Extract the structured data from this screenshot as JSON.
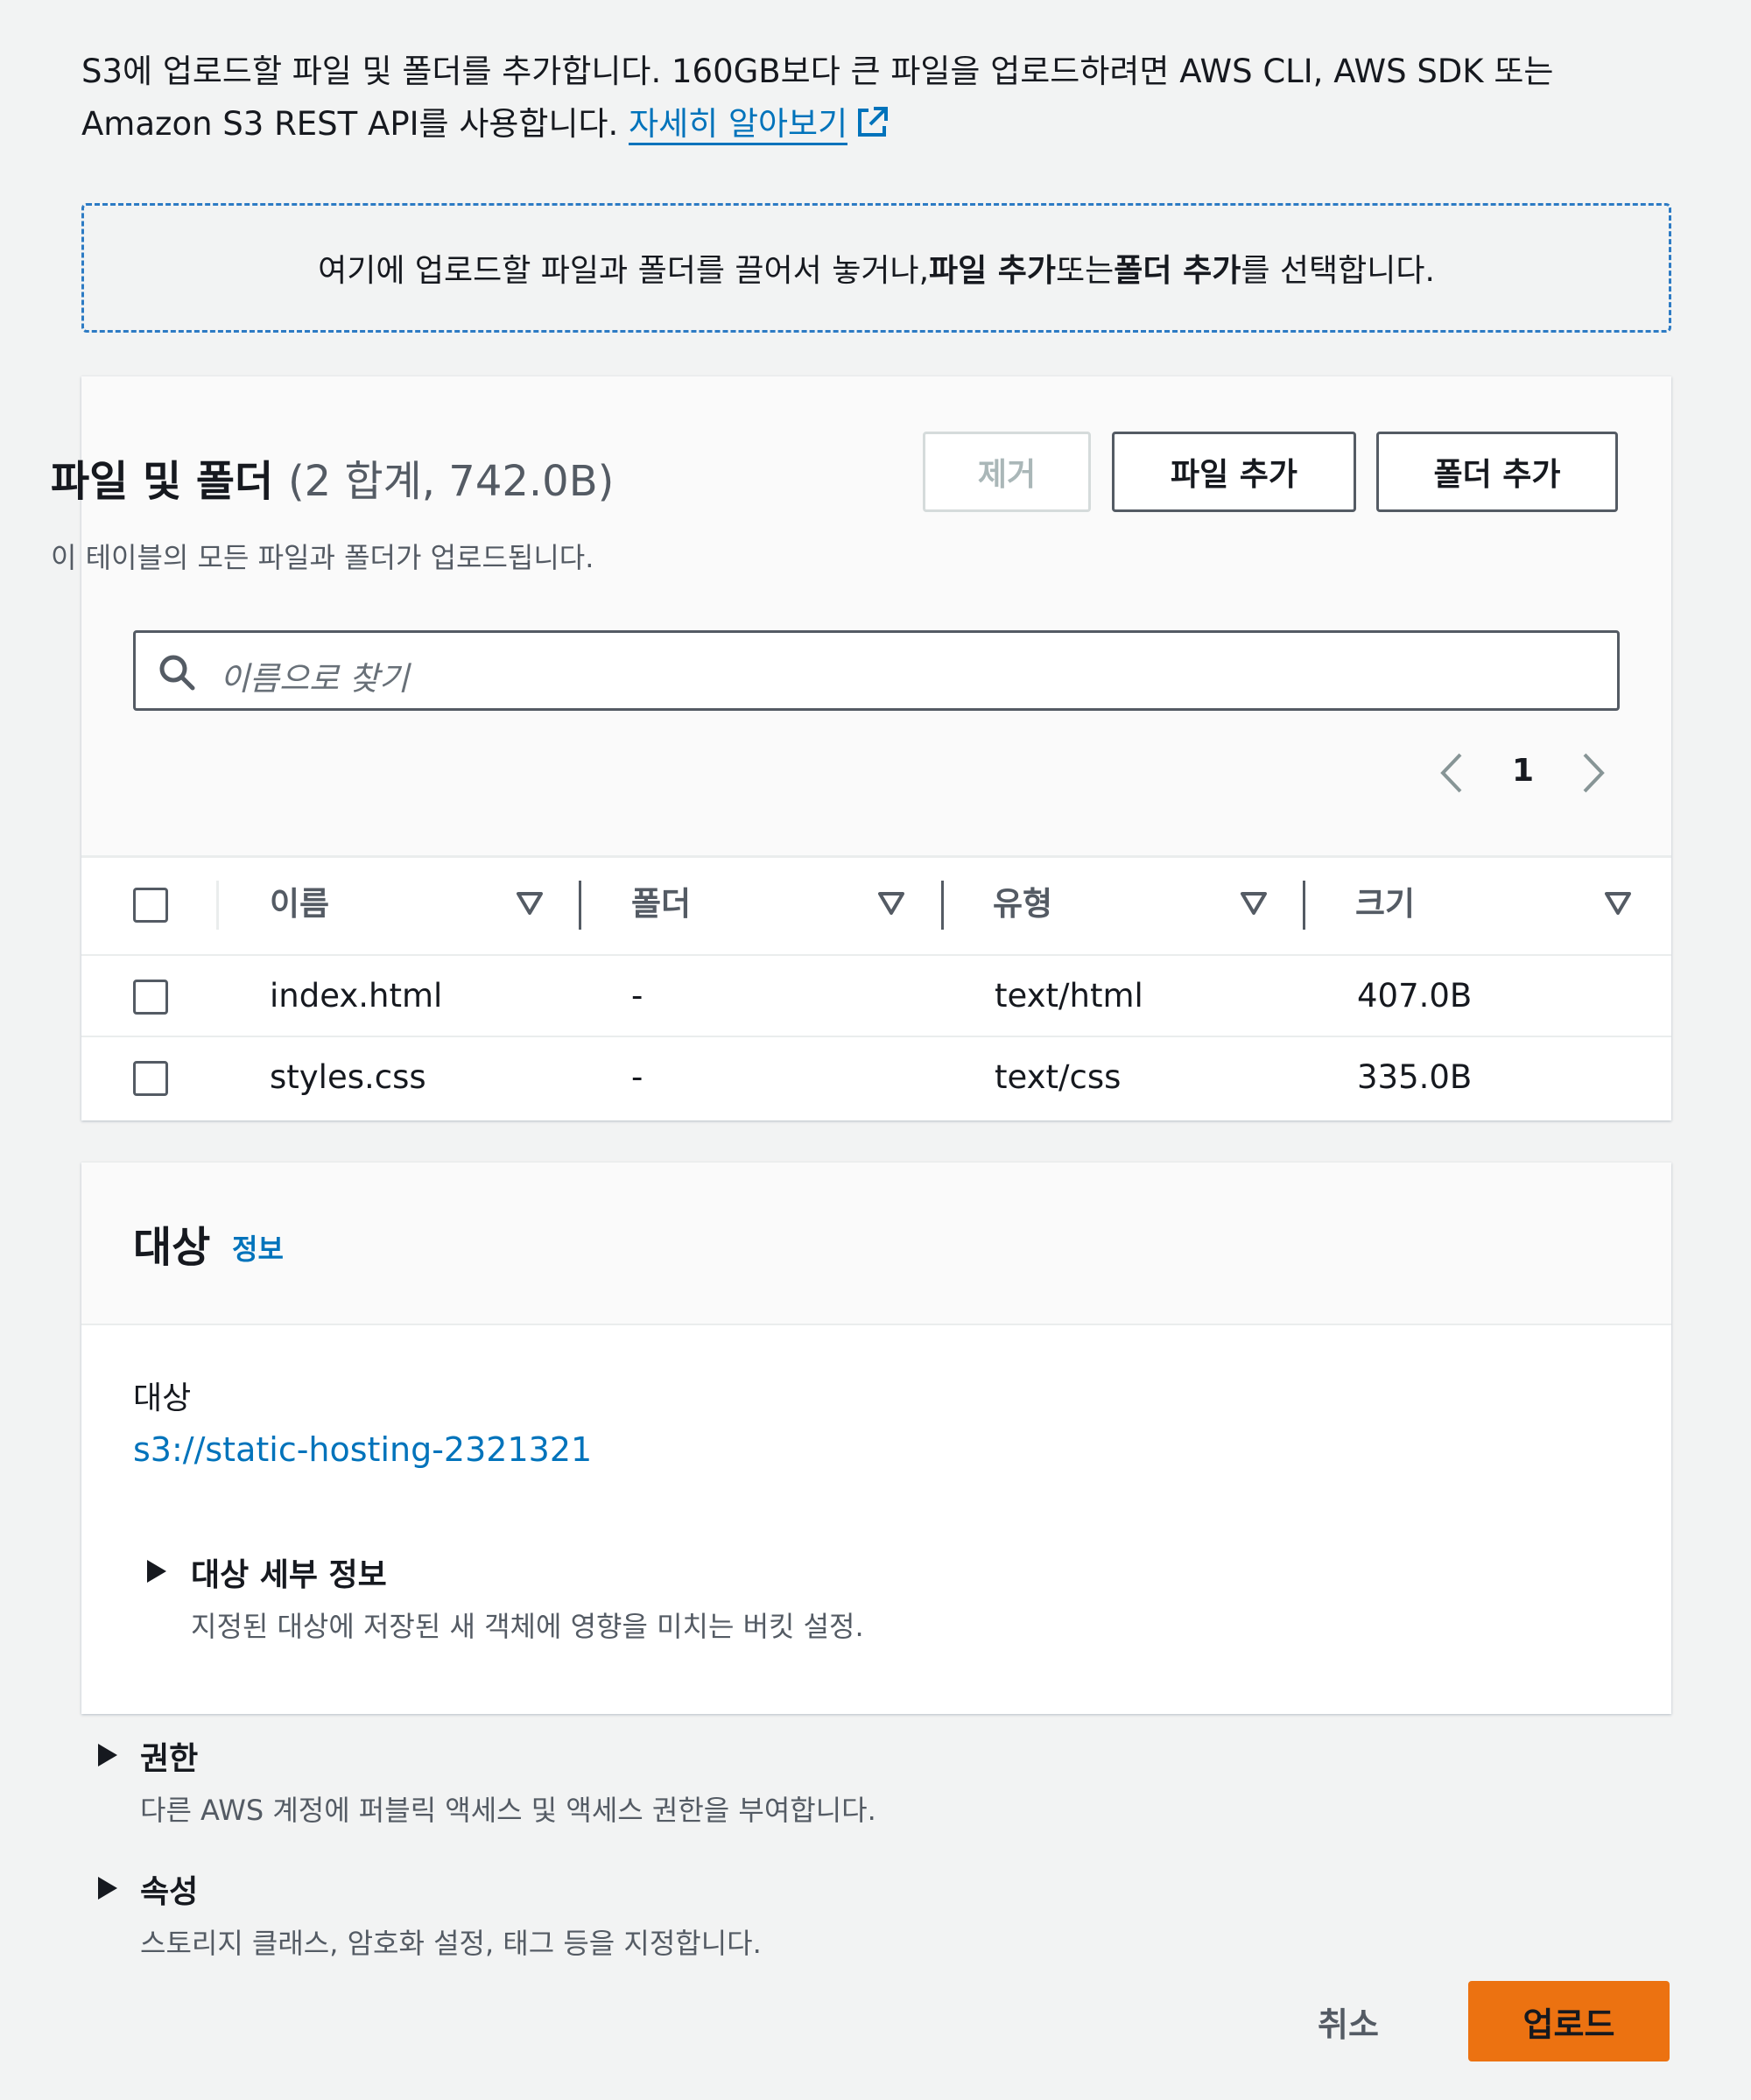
{
  "intro": {
    "text": "S3에 업로드할 파일 및 폴더를 추가합니다. 160GB보다 큰 파일을 업로드하려면 AWS CLI, AWS SDK 또는 Amazon S3 REST API를 사용합니다. ",
    "link": "자세히 알아보기"
  },
  "dropzone": {
    "prefix": "여기에 업로드할 파일과 폴더를 끌어서 놓거나, ",
    "add_files": "파일 추가",
    "middle": " 또는 ",
    "add_folder": "폴더 추가",
    "suffix": "를 선택합니다."
  },
  "files_panel": {
    "title": "파일 및 폴더",
    "count": "(2 합계, 742.0B)",
    "description": "이 테이블의 모든 파일과 폴더가 업로드됩니다.",
    "buttons": {
      "remove": "제거",
      "add_files": "파일 추가",
      "add_folder": "폴더 추가"
    },
    "search_placeholder": "이름으로 찾기",
    "page": "1",
    "columns": [
      "이름",
      "폴더",
      "유형",
      "크기"
    ],
    "rows": [
      {
        "name": "index.html",
        "folder": "-",
        "type": "text/html",
        "size": "407.0B"
      },
      {
        "name": "styles.css",
        "folder": "-",
        "type": "text/css",
        "size": "335.0B"
      }
    ]
  },
  "destination": {
    "title": "대상",
    "info": "정보",
    "label": "대상",
    "url": "s3://static-hosting-2321321",
    "details_title": "대상 세부 정보",
    "details_desc": "지정된 대상에 저장된 새 객체에 영향을 미치는 버킷 설정."
  },
  "permissions": {
    "title": "권한",
    "desc": "다른 AWS 계정에 퍼블릭 액세스 및 액세스 권한을 부여합니다."
  },
  "properties": {
    "title": "속성",
    "desc": "스토리지 클래스, 암호화 설정, 태그 등을 지정합니다."
  },
  "footer": {
    "cancel": "취소",
    "upload": "업로드"
  },
  "colors": {
    "link": "#0073bb",
    "primary_button": "#ec7211"
  },
  "icons": [
    "external-link-icon",
    "search-icon",
    "chevron-left-icon",
    "chevron-right-icon",
    "sort-icon",
    "caret-right-icon"
  ]
}
